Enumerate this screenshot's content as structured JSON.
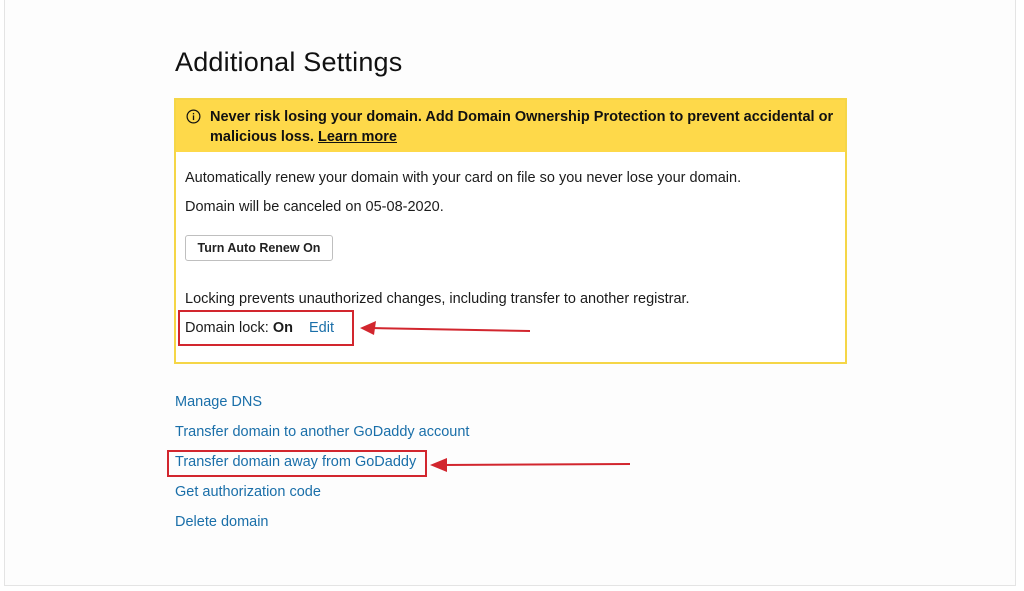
{
  "page": {
    "title": "Additional Settings"
  },
  "banner": {
    "icon": "info-icon",
    "text": "Never risk losing your domain. Add Domain Ownership Protection to prevent accidental or malicious loss.",
    "link": "Learn more",
    "background_color": "#fed94a"
  },
  "auto_renew": {
    "description": "Automatically renew your domain with your card on file so you never lose your domain.",
    "cancel_notice": "Domain will be canceled on 05-08-2020.",
    "button_label": "Turn Auto Renew On"
  },
  "domain_lock": {
    "description": "Locking prevents unauthorized changes, including transfer to another registrar.",
    "label": "Domain lock:",
    "status": "On",
    "edit_label": "Edit"
  },
  "actions": [
    {
      "label": "Manage DNS"
    },
    {
      "label": "Transfer domain to another GoDaddy account"
    },
    {
      "label": "Transfer domain away from GoDaddy"
    },
    {
      "label": "Get authorization code"
    },
    {
      "label": "Delete domain"
    }
  ],
  "colors": {
    "link": "#1a6fa9",
    "annotation": "#d2262e",
    "panel_border": "#f5d647"
  }
}
